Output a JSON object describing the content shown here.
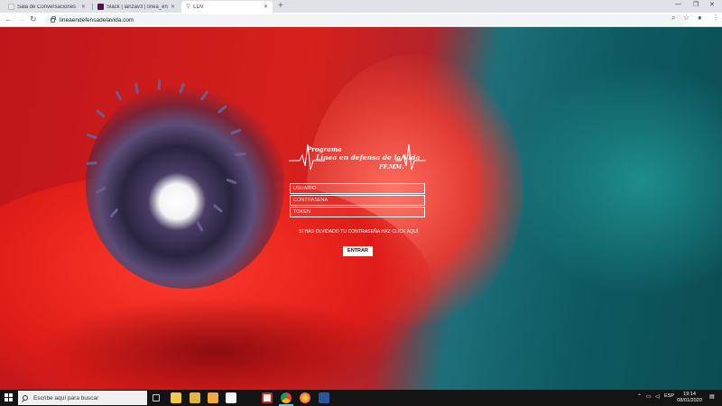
{
  "browser": {
    "tabs": [
      {
        "title": "Sala de Conversaciones",
        "favicon_color": "#e8eaed"
      },
      {
        "title": "Slack | lanzav3 | linea_en_defensa",
        "favicon_color": "#4a154b"
      },
      {
        "title": "LDV",
        "favicon_color": "#9aa0a6"
      }
    ],
    "address": {
      "url": "lineaendefensadelavida.com"
    }
  },
  "login": {
    "brand": {
      "programa": "Programa",
      "main": "Línea en defensa de la Vida",
      "suffix": "FF.MM."
    },
    "usuario_placeholder": "USUARIO",
    "contrasena_placeholder": "CONTRASEÑA",
    "token_placeholder": "TOKEN",
    "forgot_text": "SI HAS OLVIDADO TU CONTRASEÑA HAZ CLICK AQUÍ.",
    "submit_label": "ENTRAR"
  },
  "taskbar": {
    "search_placeholder": "Escribe aquí para buscar",
    "language": "ESP",
    "time": "19:14",
    "date": "08/01/2020"
  },
  "colors": {
    "poppy_red": "#d6201c",
    "teal": "#0d5a61",
    "taskbar": "#141414"
  }
}
